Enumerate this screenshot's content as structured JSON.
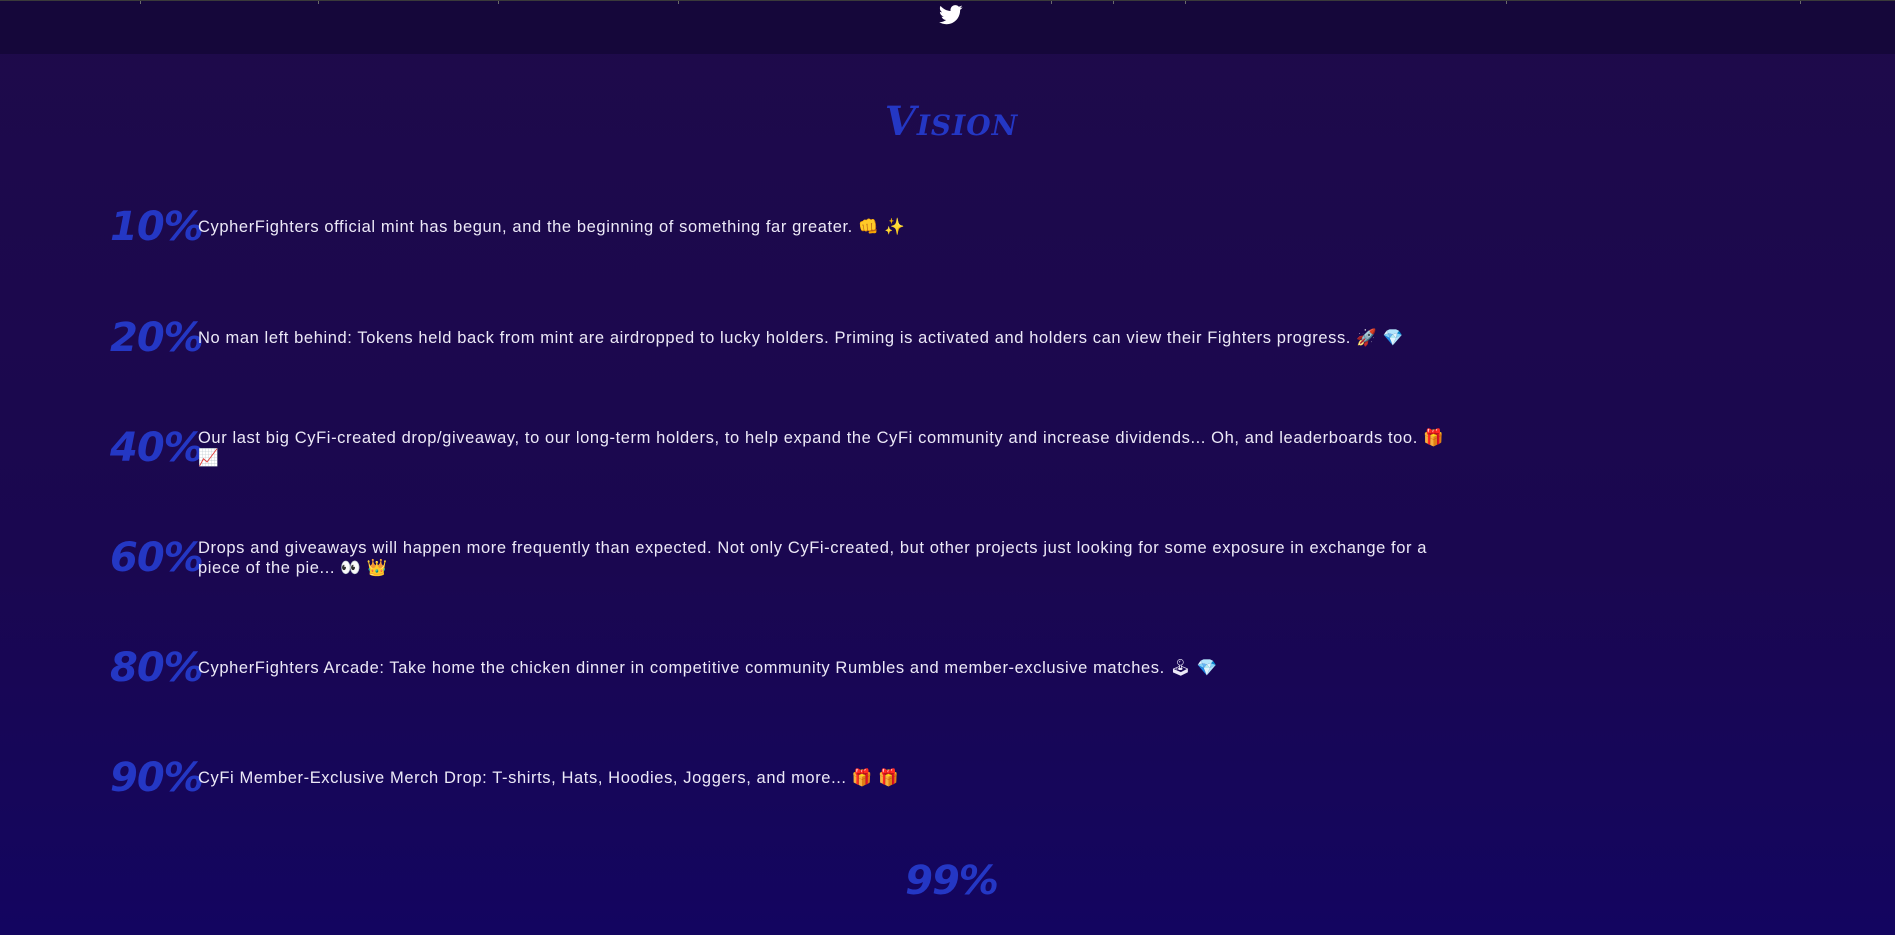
{
  "header": {
    "twitter_icon": "twitter-icon"
  },
  "vision": {
    "title": "Vision",
    "milestones": [
      {
        "percent": "10%",
        "text": "CypherFighters official mint has begun, and the beginning of something far greater. 👊 ✨"
      },
      {
        "percent": "20%",
        "text": "No man left behind: Tokens held back from mint are airdropped to lucky holders. Priming is activated and holders can view their Fighters progress. 🚀 💎"
      },
      {
        "percent": "40%",
        "text": "Our last big CyFi-created drop/giveaway, to our long-term holders, to help expand the CyFi community and increase dividends... Oh, and leaderboards too. 🎁 📈"
      },
      {
        "percent": "60%",
        "text": "Drops and giveaways will happen more frequently than expected. Not only CyFi-created, but other projects just looking for some exposure in exchange for a piece of the pie... 👀 👑"
      },
      {
        "percent": "80%",
        "text": "CypherFighters Arcade: Take home the chicken dinner in competitive community Rumbles and member-exclusive matches. 🕹 💎"
      },
      {
        "percent": "90%",
        "text": "CyFi Member-Exclusive Merch Drop: T-shirts, Hats, Hoodies, Joggers, and more... 🎁 🎁"
      }
    ],
    "final_percent": "99%"
  },
  "colors": {
    "accent": "#2437c4",
    "text": "#ece9f7",
    "background": "#1a0750"
  }
}
